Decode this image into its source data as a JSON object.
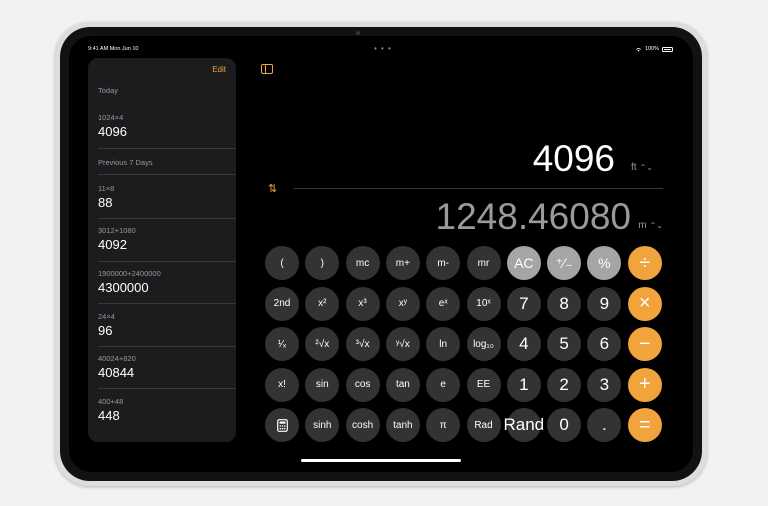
{
  "status": {
    "time_date": "9:41 AM   Mon Jun 10",
    "battery": "100%",
    "multitask": "• • •"
  },
  "sidebar": {
    "edit_label": "Edit",
    "sections": [
      {
        "title": "Today",
        "entries": [
          {
            "expr": "1024×4",
            "result": "4096"
          }
        ]
      },
      {
        "title": "Previous 7 Days",
        "entries": [
          {
            "expr": "11×8",
            "result": "88"
          },
          {
            "expr": "3012+1080",
            "result": "4092"
          },
          {
            "expr": "1900000+2400000",
            "result": "4300000"
          },
          {
            "expr": "24×4",
            "result": "96"
          },
          {
            "expr": "40024+820",
            "result": "40844"
          },
          {
            "expr": "400+48",
            "result": "448"
          }
        ]
      }
    ]
  },
  "display": {
    "primary_value": "4096",
    "primary_unit": "ft",
    "secondary_value": "1248.46080",
    "secondary_unit": "m",
    "chevron": "⌃⌄",
    "convert_symbol": "⇅"
  },
  "keypad": {
    "rows": [
      [
        "(",
        ")",
        "mc",
        "m+",
        "m-",
        "mr",
        "AC",
        "⁺∕₋",
        "%",
        "÷"
      ],
      [
        "2nd",
        "x²",
        "x³",
        "xʸ",
        "eˣ",
        "10ˣ",
        "7",
        "8",
        "9",
        "×"
      ],
      [
        "¹⁄ₓ",
        "²√x",
        "³√x",
        "ʸ√x",
        "ln",
        "log₁₀",
        "4",
        "5",
        "6",
        "−"
      ],
      [
        "x!",
        "sin",
        "cos",
        "tan",
        "e",
        "EE",
        "1",
        "2",
        "3",
        "+"
      ],
      [
        "calculator-icon",
        "sinh",
        "cosh",
        "tanh",
        "π",
        "Rad",
        "Rand",
        "0",
        ".",
        "="
      ]
    ]
  },
  "colors": {
    "accent": "#f1a33c",
    "key_dark": "#333335",
    "key_light": "#a5a5a5"
  }
}
